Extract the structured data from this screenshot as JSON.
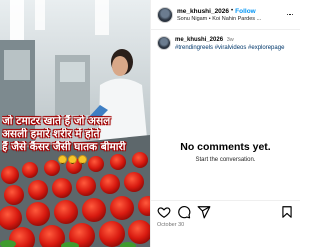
{
  "post": {
    "username": "me_khushi_2026",
    "follow_label": "Follow",
    "audio": "Sonu Nigam • Koi Nahin Pardes ...",
    "caption": {
      "username": "me_khushi_2026",
      "time": "3w",
      "hashtags": "#trendingreels #viralvideos #explorepage"
    },
    "empty_title": "No comments yet.",
    "empty_subtitle": "Start the conversation.",
    "date": "October 30"
  },
  "media": {
    "overlay_lines": [
      "जो टमाटर खाते हैं जो असल",
      "असली हमारे शरीर में होते",
      "हैं जैसे कैंसर जैसी घातक बीमारी"
    ]
  },
  "icons": {
    "like": "heart-icon",
    "comment": "comment-icon",
    "share": "send-icon",
    "save": "bookmark-icon",
    "more": "more-icon"
  },
  "colors": {
    "follow": "#0095f6",
    "hashtags": "#00376b",
    "overlay_text": "#ffffff",
    "overlay_outline": "#b00000"
  }
}
